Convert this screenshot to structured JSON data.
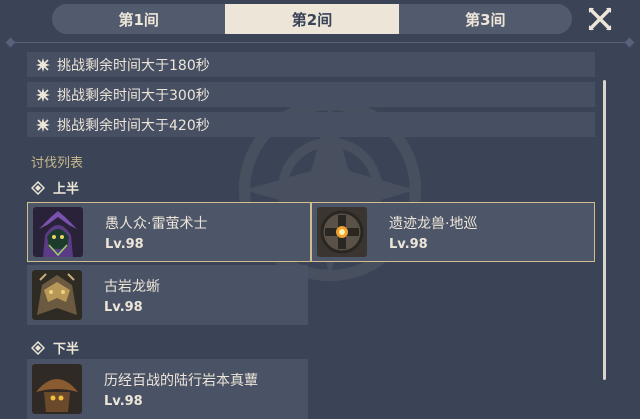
{
  "tabs": [
    {
      "label": "第1间",
      "active": false
    },
    {
      "label": "第2间",
      "active": true
    },
    {
      "label": "第3间",
      "active": false
    }
  ],
  "conditions": [
    "挑战剩余时间大于180秒",
    "挑战剩余时间大于300秒",
    "挑战剩余时间大于420秒"
  ],
  "enemy_list_title": "讨伐列表",
  "first_half": {
    "label": "上半",
    "enemies": [
      {
        "name": "愚人众·雷萤术士",
        "level": "Lv.98",
        "icon": "cicin-mage-portrait",
        "selected": true
      },
      {
        "name": "遗迹龙兽·地巡",
        "level": "Lv.98",
        "icon": "ruin-drake-portrait",
        "selected": true
      },
      {
        "name": "古岩龙蜥",
        "level": "Lv.98",
        "icon": "primo-geovishap-portrait",
        "selected": false
      }
    ]
  },
  "second_half": {
    "label": "下半",
    "enemies": [
      {
        "name": "历经百战的陆行岩本真蕈",
        "level": "Lv.98",
        "icon": "grounded-geoshroom-portrait",
        "selected": false
      }
    ]
  },
  "colors": {
    "background": "#3b4356",
    "active_tab": "#ece5d8",
    "accent_gold": "#d3bc8e",
    "text": "#ece5d8"
  }
}
